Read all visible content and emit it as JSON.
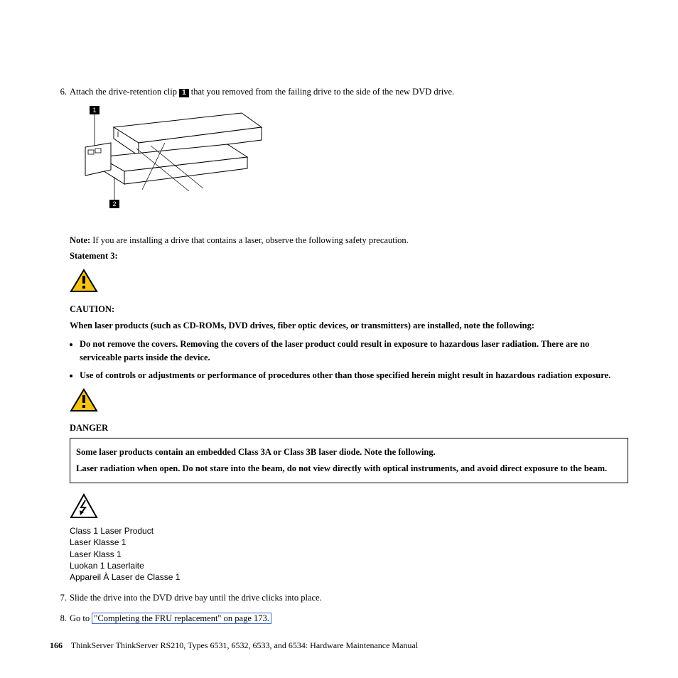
{
  "steps": {
    "s6num": "6.",
    "s6a": "Attach the drive-retention clip ",
    "s6callout": "1",
    "s6b": " that you removed from the failing drive to the side of the new DVD drive.",
    "s7num": "7.",
    "s7text": "Slide the drive into the DVD drive bay until the drive clicks into place.",
    "s8num": "8.",
    "s8a": "Go to ",
    "s8link": "\"Completing the FRU replacement\" on page 173."
  },
  "diagram_callouts": {
    "c1": "1",
    "c2": "2"
  },
  "note": {
    "lead": "Note:",
    "text": " If you are installing a drive that contains a laser, observe the following safety precaution.",
    "statement": "Statement 3:"
  },
  "caution": {
    "heading": "CAUTION:",
    "intro": "When laser products (such as CD-ROMs, DVD drives, fiber optic devices, or transmitters) are installed, note the following:",
    "b1": "Do not remove the covers. Removing the covers of the laser product could result in exposure to hazardous laser radiation. There are no serviceable parts inside the device.",
    "b2": "Use of controls or adjustments or performance of procedures other than those specified herein might result in hazardous radiation exposure."
  },
  "danger": {
    "heading": "DANGER",
    "p1": "Some laser products contain an embedded Class 3A or Class 3B laser diode. Note the following.",
    "p2": "Laser radiation when open. Do not stare into the beam, do not view directly with optical instruments, and avoid direct exposure to the beam."
  },
  "laser": {
    "l1": "Class 1 Laser Product",
    "l2": "Laser Klasse 1",
    "l3": "Laser Klass 1",
    "l4": "Luokan 1 Laserlaite",
    "l5": "Appareil À Laser de Classe 1"
  },
  "footer": {
    "pagenum": "166",
    "text": "ThinkServer ThinkServer RS210, Types 6531, 6532, 6533, and 6534: Hardware Maintenance Manual"
  }
}
